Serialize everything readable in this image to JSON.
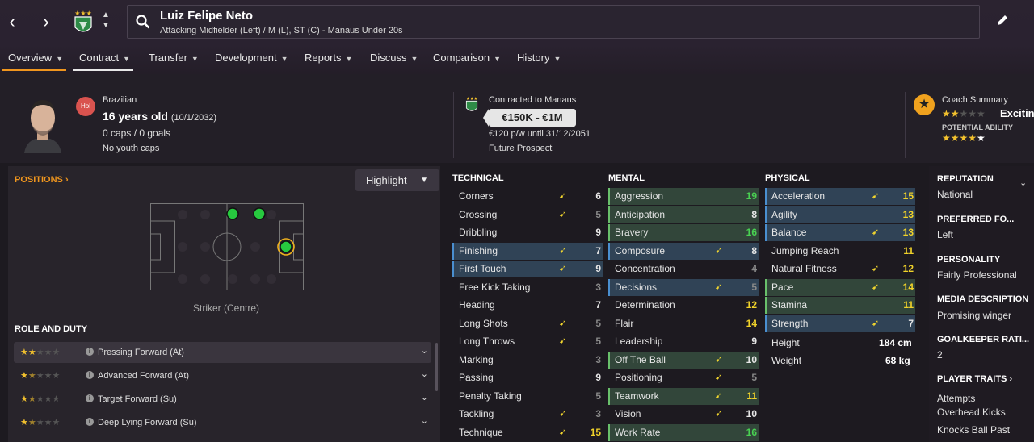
{
  "nav": {
    "back": "‹",
    "forward": "›"
  },
  "player": {
    "name": "Luiz Felipe Neto",
    "positions_line": "Attacking Midfielder (Left) / M (L), ST (C) - Manaus Under 20s"
  },
  "tabs": [
    {
      "label": "Overview"
    },
    {
      "label": "Contract"
    },
    {
      "label": "Transfer"
    },
    {
      "label": "Development"
    },
    {
      "label": "Reports"
    },
    {
      "label": "Discuss"
    },
    {
      "label": "Comparison"
    },
    {
      "label": "History"
    }
  ],
  "header": {
    "status_badge": "Hol",
    "nationality": "Brazilian",
    "age_bold": "16 years old",
    "dob": "(10/1/2032)",
    "caps": "0 caps / 0 goals",
    "youth": "No youth caps",
    "contract_label": "Contracted to Manaus",
    "value": "€150K - €1M",
    "wage": "€120 p/w until 31/12/2051",
    "status": "Future Prospect",
    "coach_summary_label": "Coach Summary",
    "coach_summary_word": "Excitin",
    "potential_label": "POTENTIAL ABILITY",
    "current_stars": 2,
    "potential_stars": 4.5
  },
  "positions": {
    "title": "POSITIONS",
    "highlight_label": "Highlight",
    "caption": "Striker (Centre)"
  },
  "role_duty": {
    "title": "ROLE AND DUTY",
    "roles": [
      {
        "label": "Pressing Forward (At)",
        "stars": 2
      },
      {
        "label": "Advanced Forward (At)",
        "stars": 1.5
      },
      {
        "label": "Target Forward (Su)",
        "stars": 1.5
      },
      {
        "label": "Deep Lying Forward (Su)",
        "stars": 1.5
      }
    ]
  },
  "technical": {
    "title": "TECHNICAL",
    "attrs": [
      {
        "name": "Corners",
        "value": "6",
        "arrow": true,
        "hl": "",
        "color": "w"
      },
      {
        "name": "Crossing",
        "value": "5",
        "arrow": true,
        "hl": "",
        "color": "g"
      },
      {
        "name": "Dribbling",
        "value": "9",
        "arrow": false,
        "hl": "",
        "color": "w"
      },
      {
        "name": "Finishing",
        "value": "7",
        "arrow": true,
        "hl": "blue",
        "color": "w"
      },
      {
        "name": "First Touch",
        "value": "9",
        "arrow": true,
        "hl": "blue",
        "color": "w"
      },
      {
        "name": "Free Kick Taking",
        "value": "3",
        "arrow": false,
        "hl": "",
        "color": "g"
      },
      {
        "name": "Heading",
        "value": "7",
        "arrow": false,
        "hl": "",
        "color": "w"
      },
      {
        "name": "Long Shots",
        "value": "5",
        "arrow": true,
        "hl": "",
        "color": "g"
      },
      {
        "name": "Long Throws",
        "value": "5",
        "arrow": true,
        "hl": "",
        "color": "g"
      },
      {
        "name": "Marking",
        "value": "3",
        "arrow": false,
        "hl": "",
        "color": "g"
      },
      {
        "name": "Passing",
        "value": "9",
        "arrow": false,
        "hl": "",
        "color": "w"
      },
      {
        "name": "Penalty Taking",
        "value": "5",
        "arrow": false,
        "hl": "",
        "color": "g"
      },
      {
        "name": "Tackling",
        "value": "3",
        "arrow": true,
        "hl": "",
        "color": "g"
      },
      {
        "name": "Technique",
        "value": "15",
        "arrow": true,
        "hl": "",
        "color": "y"
      }
    ]
  },
  "mental": {
    "title": "MENTAL",
    "attrs": [
      {
        "name": "Aggression",
        "value": "19",
        "arrow": false,
        "hl": "green",
        "color": "gr"
      },
      {
        "name": "Anticipation",
        "value": "8",
        "arrow": false,
        "hl": "green",
        "color": "w"
      },
      {
        "name": "Bravery",
        "value": "16",
        "arrow": false,
        "hl": "green",
        "color": "gr"
      },
      {
        "name": "Composure",
        "value": "8",
        "arrow": true,
        "hl": "blue",
        "color": "w"
      },
      {
        "name": "Concentration",
        "value": "4",
        "arrow": false,
        "hl": "",
        "color": "g"
      },
      {
        "name": "Decisions",
        "value": "5",
        "arrow": true,
        "hl": "blue",
        "color": "g"
      },
      {
        "name": "Determination",
        "value": "12",
        "arrow": false,
        "hl": "",
        "color": "y"
      },
      {
        "name": "Flair",
        "value": "14",
        "arrow": false,
        "hl": "",
        "color": "y"
      },
      {
        "name": "Leadership",
        "value": "9",
        "arrow": false,
        "hl": "",
        "color": "w"
      },
      {
        "name": "Off The Ball",
        "value": "10",
        "arrow": true,
        "hl": "green",
        "color": "w"
      },
      {
        "name": "Positioning",
        "value": "5",
        "arrow": true,
        "hl": "",
        "color": "g"
      },
      {
        "name": "Teamwork",
        "value": "11",
        "arrow": true,
        "hl": "green",
        "color": "y"
      },
      {
        "name": "Vision",
        "value": "10",
        "arrow": true,
        "hl": "",
        "color": "w"
      },
      {
        "name": "Work Rate",
        "value": "16",
        "arrow": false,
        "hl": "green",
        "color": "gr"
      }
    ]
  },
  "physical": {
    "title": "PHYSICAL",
    "attrs": [
      {
        "name": "Acceleration",
        "value": "15",
        "arrow": true,
        "hl": "blue",
        "color": "y"
      },
      {
        "name": "Agility",
        "value": "13",
        "arrow": false,
        "hl": "blue",
        "color": "y"
      },
      {
        "name": "Balance",
        "value": "13",
        "arrow": true,
        "hl": "blue",
        "color": "y"
      },
      {
        "name": "Jumping Reach",
        "value": "11",
        "arrow": false,
        "hl": "",
        "color": "y"
      },
      {
        "name": "Natural Fitness",
        "value": "12",
        "arrow": true,
        "hl": "",
        "color": "y"
      },
      {
        "name": "Pace",
        "value": "14",
        "arrow": true,
        "hl": "green",
        "color": "y"
      },
      {
        "name": "Stamina",
        "value": "11",
        "arrow": false,
        "hl": "green",
        "color": "y"
      },
      {
        "name": "Strength",
        "value": "7",
        "arrow": true,
        "hl": "blue",
        "color": "w"
      }
    ],
    "height_label": "Height",
    "height": "184 cm",
    "weight_label": "Weight",
    "weight": "68 kg"
  },
  "right_panel": {
    "reputation_label": "REPUTATION",
    "reputation": "National",
    "foot_label": "PREFERRED FO...",
    "foot": "Left",
    "personality_label": "PERSONALITY",
    "personality": "Fairly Professional",
    "media_label": "MEDIA DESCRIPTION",
    "media": "Promising winger",
    "gk_label": "GOALKEEPER RATI...",
    "gk": "2",
    "traits_label": "PLAYER TRAITS",
    "traits": [
      "Attempts",
      "Overhead Kicks",
      "Knocks Ball Past"
    ]
  },
  "colors": {
    "accent": "#f0961e",
    "green": "#49d052",
    "yellow": "#f0d22a",
    "blue_hl": "#304356",
    "green_hl": "#32463a"
  }
}
